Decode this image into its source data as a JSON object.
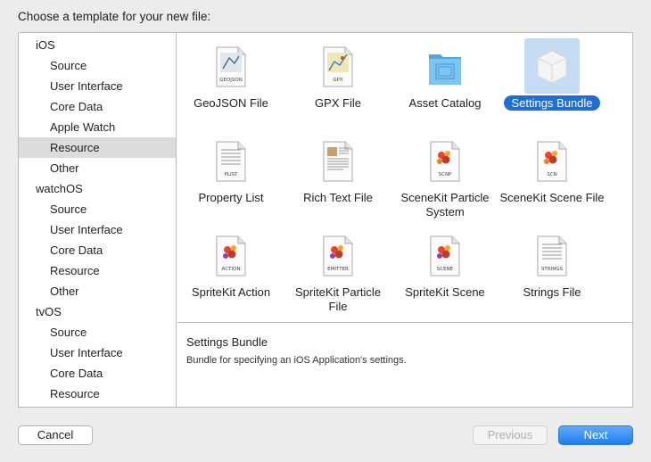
{
  "header": {
    "title": "Choose a template for your new file:"
  },
  "sidebar": {
    "rows": [
      {
        "label": "iOS",
        "kind": "group"
      },
      {
        "label": "Source",
        "kind": "item"
      },
      {
        "label": "User Interface",
        "kind": "item"
      },
      {
        "label": "Core Data",
        "kind": "item"
      },
      {
        "label": "Apple Watch",
        "kind": "item"
      },
      {
        "label": "Resource",
        "kind": "item",
        "selected": true
      },
      {
        "label": "Other",
        "kind": "item"
      },
      {
        "label": "watchOS",
        "kind": "group"
      },
      {
        "label": "Source",
        "kind": "item"
      },
      {
        "label": "User Interface",
        "kind": "item"
      },
      {
        "label": "Core Data",
        "kind": "item"
      },
      {
        "label": "Resource",
        "kind": "item"
      },
      {
        "label": "Other",
        "kind": "item"
      },
      {
        "label": "tvOS",
        "kind": "group"
      },
      {
        "label": "Source",
        "kind": "item"
      },
      {
        "label": "User Interface",
        "kind": "item"
      },
      {
        "label": "Core Data",
        "kind": "item"
      },
      {
        "label": "Resource",
        "kind": "item"
      }
    ]
  },
  "templates": [
    {
      "name": "GeoJSON File",
      "icon": "geojson-file-icon",
      "badge": "GEOJSON"
    },
    {
      "name": "GPX File",
      "icon": "gpx-file-icon",
      "badge": "GPX"
    },
    {
      "name": "Asset Catalog",
      "icon": "asset-catalog-folder-icon",
      "badge": ""
    },
    {
      "name": "Settings Bundle",
      "icon": "settings-bundle-icon",
      "badge": "",
      "selected": true
    },
    {
      "name": "Property List",
      "icon": "property-list-icon",
      "badge": "PLIST"
    },
    {
      "name": "Rich Text File",
      "icon": "rich-text-file-icon",
      "badge": ""
    },
    {
      "name": "SceneKit Particle System",
      "icon": "scenekit-particle-icon",
      "badge": "SCNP"
    },
    {
      "name": "SceneKit Scene File",
      "icon": "scenekit-scene-icon",
      "badge": "SCN"
    },
    {
      "name": "SpriteKit Action",
      "icon": "spritekit-action-icon",
      "badge": "ACTION"
    },
    {
      "name": "SpriteKit Particle File",
      "icon": "spritekit-particle-icon",
      "badge": "EMITTER"
    },
    {
      "name": "SpriteKit Scene",
      "icon": "spritekit-scene-icon",
      "badge": "SCENE"
    },
    {
      "name": "Strings File",
      "icon": "strings-file-icon",
      "badge": "STRINGS"
    }
  ],
  "description": {
    "title": "Settings Bundle",
    "text": "Bundle for specifying an iOS Application's settings."
  },
  "buttons": {
    "cancel": "Cancel",
    "previous": "Previous",
    "next": "Next"
  },
  "colors": {
    "accent": "#1f6fd3",
    "selection_bg": "#c6dcf5",
    "sidebar_selection": "#dcdcdc"
  }
}
